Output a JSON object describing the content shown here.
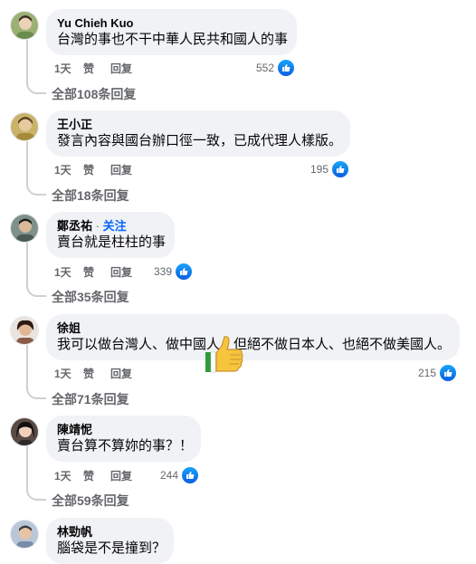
{
  "comments": [
    {
      "name": "Yu Chieh Kuo",
      "text": "台灣的事也不干中華人民共和國人的事",
      "time": "1天",
      "like": "赞",
      "reply": "回复",
      "reactions": "552",
      "replies": "全部108条回复",
      "avatar_color": "#6b8b4d"
    },
    {
      "name": "王小正",
      "text": "發言內容與國台辦口徑一致，已成代理人樣版。",
      "time": "1天",
      "like": "赞",
      "reply": "回复",
      "reactions": "195",
      "replies": "全部18条回复",
      "avatar_color": "#a88a3c"
    },
    {
      "name": "鄭丞祐",
      "dot": " · ",
      "follow": "关注",
      "text": "賣台就是柱柱的事",
      "time": "1天",
      "like": "赞",
      "reply": "回复",
      "reactions": "339",
      "replies": "全部35条回复",
      "avatar_color": "#4a5a55"
    },
    {
      "name": "徐姐",
      "text": "我可以做台灣人、做中國人，但絕不做日本人、也絕不做美國人。",
      "time": "1天",
      "like": "赞",
      "reply": "回复",
      "reactions": "215",
      "replies": "全部71条回复",
      "avatar_color": "#8c5a48"
    },
    {
      "name": "陳靖怩",
      "text": "賣台算不算妳的事？！",
      "time": "1天",
      "like": "赞",
      "reply": "回复",
      "reactions": "244",
      "replies": "全部59条回复",
      "avatar_color": "#2b2b2b"
    },
    {
      "name": "林勁帆",
      "text": "腦袋是不是撞到？",
      "avatar_color": "#7a8ca8"
    }
  ],
  "icons": {
    "like": "thumbs-up-icon",
    "sticker": "thumbs-up-sticker"
  },
  "colors": {
    "like_blue": "#0866ff",
    "bubble": "#f0f2f5",
    "secondary_text": "#65676b"
  }
}
